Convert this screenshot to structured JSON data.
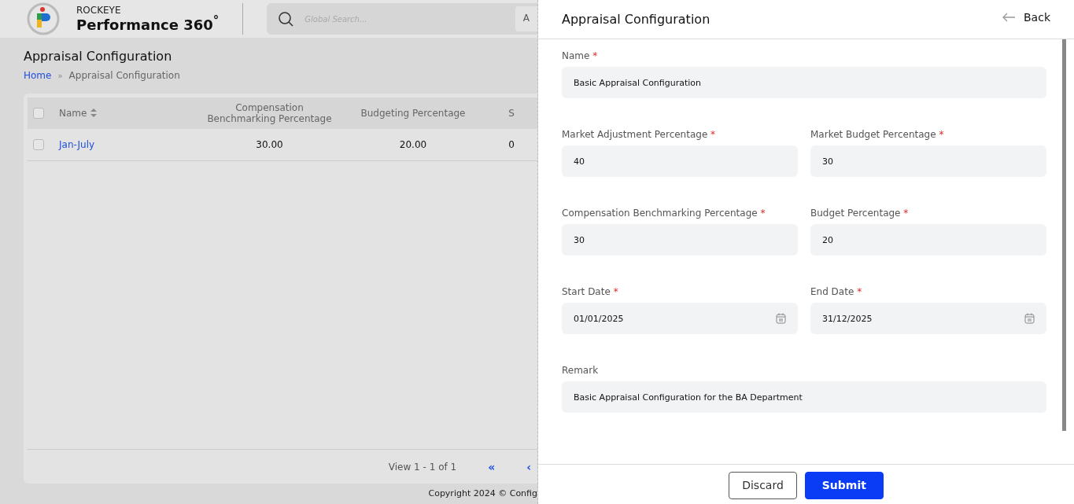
{
  "app": {
    "brand_top": "ROCKEYE",
    "brand_name": "Performance 360",
    "brand_degree": "°",
    "search_placeholder": "Global Search...",
    "header_button_fragment": "A"
  },
  "page": {
    "title": "Appraisal Configuration",
    "breadcrumb_separator": "»",
    "breadcrumb": [
      {
        "label": "Home",
        "link": true
      },
      {
        "label": "Appraisal Configuration",
        "link": false
      }
    ]
  },
  "table": {
    "columns": [
      {
        "label": "Name",
        "sortable": true
      },
      {
        "label": "Compensation Benchmarking Percentage",
        "sortable": false
      },
      {
        "label": "Budgeting Percentage",
        "sortable": false
      },
      {
        "label": "S",
        "sortable": false
      }
    ],
    "rows": [
      {
        "checked": false,
        "cells": [
          "Jan-July",
          "30.00",
          "20.00",
          "0"
        ]
      }
    ],
    "header_checked": false,
    "pagination": {
      "summary": "View 1 - 1 of 1",
      "first": "«",
      "prev": "‹"
    }
  },
  "footer": {
    "copyright": "Copyright 2024 © Config"
  },
  "drawer": {
    "title": "Appraisal Configuration",
    "back": "Back",
    "required_mark": "*",
    "form_rows": [
      [
        {
          "label": "Name",
          "required": true,
          "value": "Basic Appraisal Configuration",
          "kind": "text"
        }
      ],
      [
        {
          "label": "Market Adjustment Percentage",
          "required": true,
          "value": "40",
          "kind": "text"
        },
        {
          "label": "Market Budget Percentage",
          "required": true,
          "value": "30",
          "kind": "text"
        }
      ],
      [
        {
          "label": "Compensation Benchmarking Percentage",
          "required": true,
          "value": "30",
          "kind": "text"
        },
        {
          "label": "Budget Percentage",
          "required": true,
          "value": "20",
          "kind": "text"
        }
      ],
      [
        {
          "label": "Start Date",
          "required": true,
          "value": "01/01/2025",
          "kind": "date"
        },
        {
          "label": "End Date",
          "required": true,
          "value": "31/12/2025",
          "kind": "date"
        }
      ],
      [
        {
          "label": "Remark",
          "required": false,
          "value": "Basic Appraisal Configuration for the BA Department",
          "kind": "text"
        }
      ]
    ],
    "buttons": [
      {
        "label": "Discard",
        "kind": "secondary"
      },
      {
        "label": "Submit",
        "kind": "primary"
      }
    ]
  }
}
